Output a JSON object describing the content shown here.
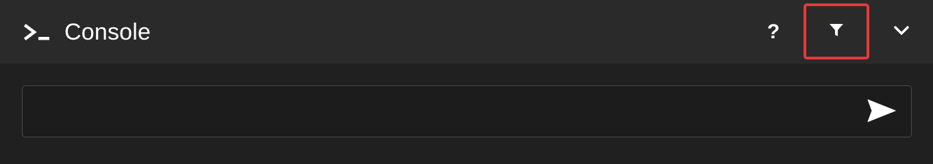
{
  "header": {
    "icon": "console-prompt-icon",
    "title": "Console",
    "help_label": "?",
    "filter_icon": "filter-funnel-icon",
    "collapse_icon": "chevron-down-icon",
    "highlight_color": "#e8383b"
  },
  "command": {
    "value": "",
    "placeholder": "",
    "send_icon": "send-arrow-icon"
  },
  "colors": {
    "background": "#202020",
    "header_background": "#2a2a2a",
    "input_border": "#4a4a4a",
    "text": "#ffffff"
  }
}
